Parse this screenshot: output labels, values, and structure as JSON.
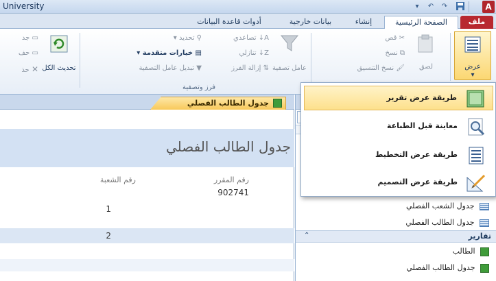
{
  "titlebar": {
    "title": "University",
    "app_icon": "A"
  },
  "tabs": {
    "file": "ملف",
    "home": "الصفحة الرئيسية",
    "create": "إنشاء",
    "external": "بيانات خارجية",
    "dbtools": "أدوات قاعدة البيانات"
  },
  "ribbon": {
    "view": "عرض",
    "paste": "لصق",
    "cut": "قص",
    "copy": "نسخ",
    "format_painter": "نسخ التنسيق",
    "filter": "عامل تصفية",
    "ascending": "تصاعدي",
    "descending": "تنازلي",
    "remove_sort": "إزالة الفرز",
    "selection": "تحديد",
    "advanced": "خيارات متقدمة",
    "toggle_filter": "تبديل عامل التصفية",
    "group_sort_filter": "فرز وتصفية",
    "refresh_all": "تحديث الكل",
    "new_partial": "جد",
    "save_partial": "حف",
    "delete_partial": "حذ"
  },
  "view_menu": {
    "items": [
      "طريقة عرض تقرير",
      "معاينة قبل الطباعة",
      "طريقة عرض التخطيط",
      "طريقة عرض التصميم"
    ]
  },
  "document": {
    "tab_title": "جدول الطالب الفصلي",
    "report_title": "جدول الطالب الفصلي",
    "columns": [
      "رقم المقرر",
      "رقم الشعبة"
    ],
    "values": {
      "course": "902741",
      "section1": "1",
      "section2": "2"
    }
  },
  "navpane": {
    "collapse_btn": "»",
    "tables": [
      "جدول الشعب الفصلي",
      "جدول الطالب الفصلي"
    ],
    "reports_header": "تقارير",
    "reports": [
      "الطالب",
      "جدول الطالب الفصلي"
    ]
  },
  "colors": {
    "file_tab": "#b8282f",
    "selected_item": "#fde08c",
    "report_band": "#d3e1f3"
  }
}
